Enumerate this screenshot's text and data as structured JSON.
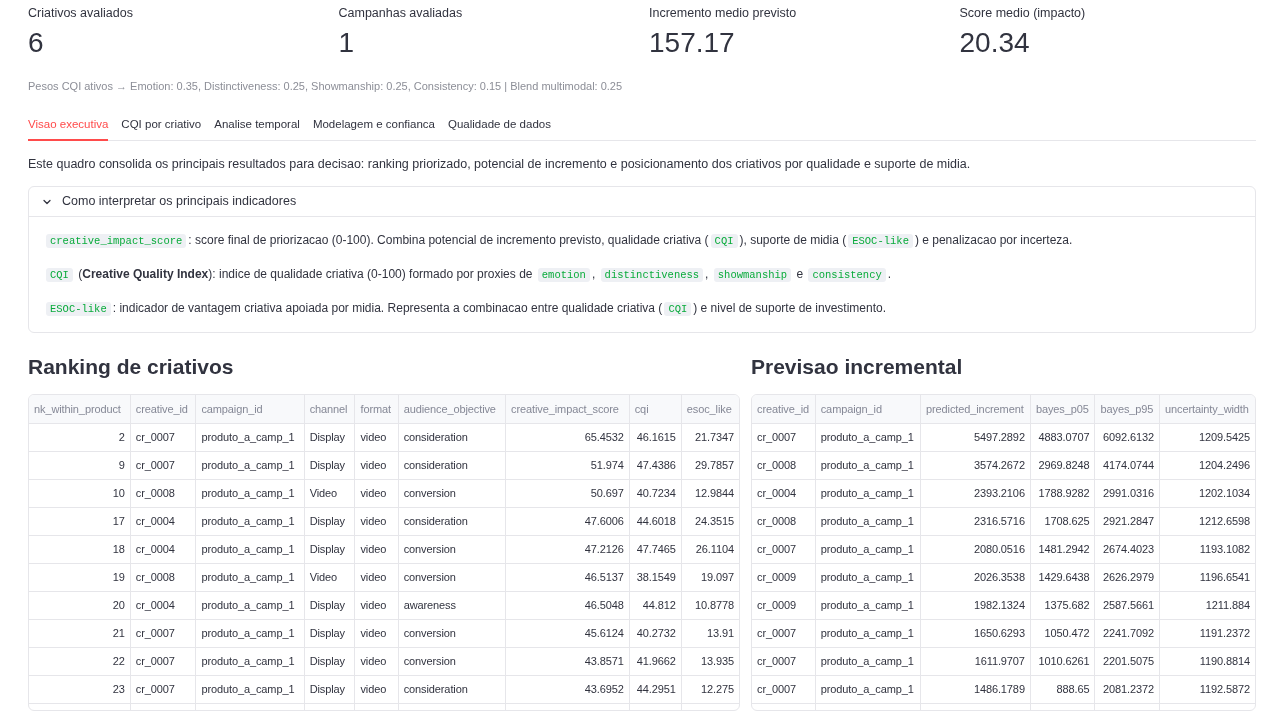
{
  "metrics": [
    {
      "label": "Criativos avaliados",
      "value": "6"
    },
    {
      "label": "Campanhas avaliadas",
      "value": "1"
    },
    {
      "label": "Incremento medio previsto",
      "value": "157.17"
    },
    {
      "label": "Score medio (impacto)",
      "value": "20.34"
    }
  ],
  "weights_caption": "Pesos CQI ativos → Emotion: 0.35, Distinctiveness: 0.25, Showmanship: 0.25, Consistency: 0.15 | Blend multimodal: 0.25",
  "tabs": [
    {
      "label": "Visao executiva",
      "selected": true
    },
    {
      "label": "CQI por criativo",
      "selected": false
    },
    {
      "label": "Analise temporal",
      "selected": false
    },
    {
      "label": "Modelagem e confianca",
      "selected": false
    },
    {
      "label": "Qualidade de dados",
      "selected": false
    }
  ],
  "intro": "Este quadro consolida os principais resultados para decisao: ranking priorizado, potencial de incremento e posicionamento dos criativos por qualidade e suporte de midia.",
  "expander": {
    "title": "Como interpretar os principais indicadores",
    "expanded": true,
    "lines": [
      {
        "segments": [
          {
            "kind": "code",
            "text": "creative_impact_score"
          },
          {
            "kind": "text",
            "text": ": score final de priorizacao (0-100). Combina potencial de incremento previsto, qualidade criativa ("
          },
          {
            "kind": "code",
            "text": "CQI"
          },
          {
            "kind": "text",
            "text": "), suporte de midia ("
          },
          {
            "kind": "code",
            "text": "ESOC-like"
          },
          {
            "kind": "text",
            "text": ") e penalizacao por incerteza."
          }
        ]
      },
      {
        "segments": [
          {
            "kind": "code",
            "text": "CQI"
          },
          {
            "kind": "text",
            "text": " (**Creative Quality Index**): indice de qualidade criativa (0-100) formado por proxies de "
          },
          {
            "kind": "code",
            "text": "emotion"
          },
          {
            "kind": "text",
            "text": ", "
          },
          {
            "kind": "code",
            "text": "distinctiveness"
          },
          {
            "kind": "text",
            "text": ", "
          },
          {
            "kind": "code",
            "text": "showmanship"
          },
          {
            "kind": "text",
            "text": " e "
          },
          {
            "kind": "code",
            "text": "consistency"
          },
          {
            "kind": "text",
            "text": "."
          }
        ]
      },
      {
        "segments": [
          {
            "kind": "code",
            "text": "ESOC-like"
          },
          {
            "kind": "text",
            "text": ": indicador de vantagem criativa apoiada por midia. Representa a combinacao entre qualidade criativa ("
          },
          {
            "kind": "code",
            "text": "CQI"
          },
          {
            "kind": "text",
            "text": ") e nivel de suporte de investimento."
          }
        ]
      }
    ]
  },
  "ranking": {
    "title": "Ranking de criativos",
    "table": {
      "columns": [
        {
          "label": "nk_within_product",
          "numeric": true
        },
        {
          "label": "creative_id",
          "numeric": false
        },
        {
          "label": "campaign_id",
          "numeric": false
        },
        {
          "label": "channel",
          "numeric": false
        },
        {
          "label": "format",
          "numeric": false
        },
        {
          "label": "audience_objective",
          "numeric": false
        },
        {
          "label": "creative_impact_score",
          "numeric": true
        },
        {
          "label": "cqi",
          "numeric": true
        },
        {
          "label": "esoc_like",
          "numeric": true
        }
      ],
      "rows": [
        [
          "2",
          "cr_0007",
          "produto_a_camp_1",
          "Display",
          "video",
          "consideration",
          "65.4532",
          "46.1615",
          "21.7347"
        ],
        [
          "9",
          "cr_0007",
          "produto_a_camp_1",
          "Display",
          "video",
          "consideration",
          "51.974",
          "47.4386",
          "29.7857"
        ],
        [
          "10",
          "cr_0008",
          "produto_a_camp_1",
          "Video",
          "video",
          "conversion",
          "50.697",
          "40.7234",
          "12.9844"
        ],
        [
          "17",
          "cr_0004",
          "produto_a_camp_1",
          "Display",
          "video",
          "consideration",
          "47.6006",
          "44.6018",
          "24.3515"
        ],
        [
          "18",
          "cr_0004",
          "produto_a_camp_1",
          "Display",
          "video",
          "conversion",
          "47.2126",
          "47.7465",
          "26.1104"
        ],
        [
          "19",
          "cr_0008",
          "produto_a_camp_1",
          "Video",
          "video",
          "conversion",
          "46.5137",
          "38.1549",
          "19.097"
        ],
        [
          "20",
          "cr_0004",
          "produto_a_camp_1",
          "Display",
          "video",
          "awareness",
          "46.5048",
          "44.812",
          "10.8778"
        ],
        [
          "21",
          "cr_0007",
          "produto_a_camp_1",
          "Display",
          "video",
          "conversion",
          "45.6124",
          "40.2732",
          "13.91"
        ],
        [
          "22",
          "cr_0007",
          "produto_a_camp_1",
          "Display",
          "video",
          "conversion",
          "43.8571",
          "41.9662",
          "13.935"
        ],
        [
          "23",
          "cr_0007",
          "produto_a_camp_1",
          "Display",
          "video",
          "consideration",
          "43.6952",
          "44.2951",
          "12.275"
        ]
      ]
    }
  },
  "forecast": {
    "title": "Previsao incremental",
    "table": {
      "columns": [
        {
          "label": "creative_id",
          "numeric": false
        },
        {
          "label": "campaign_id",
          "numeric": false
        },
        {
          "label": "predicted_increment",
          "numeric": true
        },
        {
          "label": "bayes_p05",
          "numeric": true
        },
        {
          "label": "bayes_p95",
          "numeric": true
        },
        {
          "label": "uncertainty_width",
          "numeric": true
        }
      ],
      "rows": [
        [
          "cr_0007",
          "produto_a_camp_1",
          "5497.2892",
          "4883.0707",
          "6092.6132",
          "1209.5425"
        ],
        [
          "cr_0008",
          "produto_a_camp_1",
          "3574.2672",
          "2969.8248",
          "4174.0744",
          "1204.2496"
        ],
        [
          "cr_0004",
          "produto_a_camp_1",
          "2393.2106",
          "1788.9282",
          "2991.0316",
          "1202.1034"
        ],
        [
          "cr_0008",
          "produto_a_camp_1",
          "2316.5716",
          "1708.625",
          "2921.2847",
          "1212.6598"
        ],
        [
          "cr_0007",
          "produto_a_camp_1",
          "2080.0516",
          "1481.2942",
          "2674.4023",
          "1193.1082"
        ],
        [
          "cr_0009",
          "produto_a_camp_1",
          "2026.3538",
          "1429.6438",
          "2626.2979",
          "1196.6541"
        ],
        [
          "cr_0009",
          "produto_a_camp_1",
          "1982.1324",
          "1375.682",
          "2587.5661",
          "1211.884"
        ],
        [
          "cr_0007",
          "produto_a_camp_1",
          "1650.6293",
          "1050.472",
          "2241.7092",
          "1191.2372"
        ],
        [
          "cr_0007",
          "produto_a_camp_1",
          "1611.9707",
          "1010.6261",
          "2201.5075",
          "1190.8814"
        ],
        [
          "cr_0007",
          "produto_a_camp_1",
          "1486.1789",
          "888.65",
          "2081.2372",
          "1192.5872"
        ]
      ]
    }
  }
}
